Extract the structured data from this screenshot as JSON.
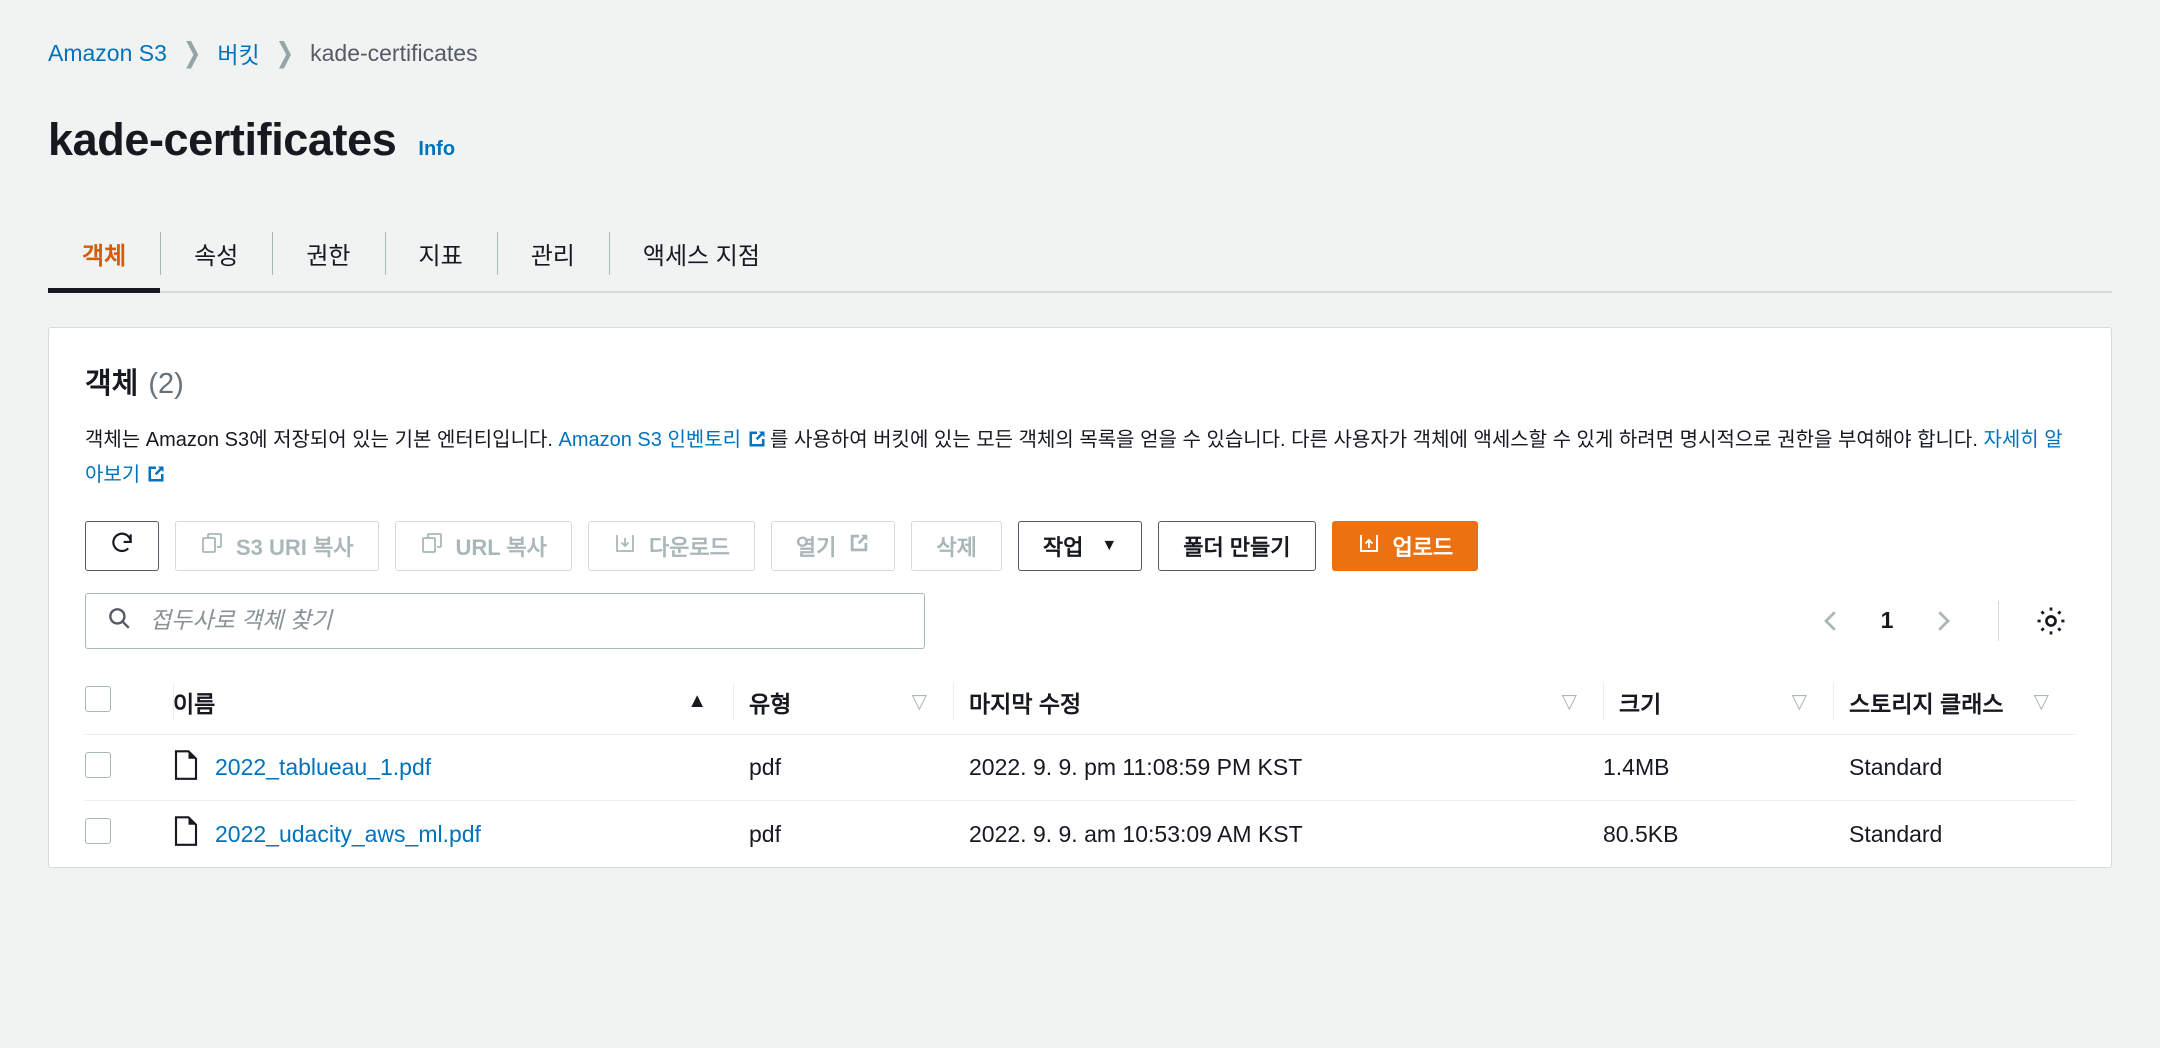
{
  "breadcrumb": {
    "items": [
      {
        "label": "Amazon S3",
        "type": "link"
      },
      {
        "label": "버킷",
        "type": "link"
      },
      {
        "label": "kade-certificates",
        "type": "current"
      }
    ],
    "separator": "❯"
  },
  "header": {
    "title": "kade-certificates",
    "info_label": "Info"
  },
  "tabs": [
    {
      "label": "객체",
      "active": true
    },
    {
      "label": "속성",
      "active": false
    },
    {
      "label": "권한",
      "active": false
    },
    {
      "label": "지표",
      "active": false
    },
    {
      "label": "관리",
      "active": false
    },
    {
      "label": "액세스 지점",
      "active": false
    }
  ],
  "panel": {
    "title": "객체",
    "count": "(2)",
    "description_part1": "객체는 Amazon S3에 저장되어 있는 기본 엔터티입니다. ",
    "inventory_link": "Amazon S3 인벤토리",
    "description_part2": "를 사용하여 버킷에 있는 모든 객체의 목록을 얻을 수 있습니다. 다른 사용자가 객체에 액세스할 수 있게 하려면 명시적으로 권한을 부여해야 합니다. ",
    "learn_more_link": "자세히 알아보기"
  },
  "toolbar": {
    "refresh_label": "새로 고침",
    "copy_s3_uri_label": "S3 URI 복사",
    "copy_url_label": "URL 복사",
    "download_label": "다운로드",
    "open_label": "열기",
    "delete_label": "삭제",
    "actions_label": "작업",
    "actions_caret": "▼",
    "create_folder_label": "폴더 만들기",
    "upload_label": "업로드"
  },
  "search": {
    "placeholder": "접두사로 객체 찾기"
  },
  "pagination": {
    "prev": "‹",
    "page": "1",
    "next": "›"
  },
  "table": {
    "columns": [
      {
        "label": "이름",
        "sort": "asc"
      },
      {
        "label": "유형",
        "sort": "none"
      },
      {
        "label": "마지막 수정",
        "sort": "none"
      },
      {
        "label": "크기",
        "sort": "none"
      },
      {
        "label": "스토리지 클래스",
        "sort": "none"
      }
    ],
    "sort_asc_glyph": "▲",
    "sort_none_glyph": "▽",
    "rows": [
      {
        "name": "2022_tablueau_1.pdf",
        "type": "pdf",
        "last_modified": "2022. 9. 9. pm 11:08:59 PM KST",
        "size": "1.4MB",
        "storage_class": "Standard"
      },
      {
        "name": "2022_udacity_aws_ml.pdf",
        "type": "pdf",
        "last_modified": "2022. 9. 9. am 10:53:09 AM KST",
        "size": "80.5KB",
        "storage_class": "Standard"
      }
    ]
  },
  "colors": {
    "accent_orange": "#ec7211",
    "link_blue": "#0073bb",
    "active_tab": "#d45b07",
    "page_bg": "#f1f3f3"
  }
}
